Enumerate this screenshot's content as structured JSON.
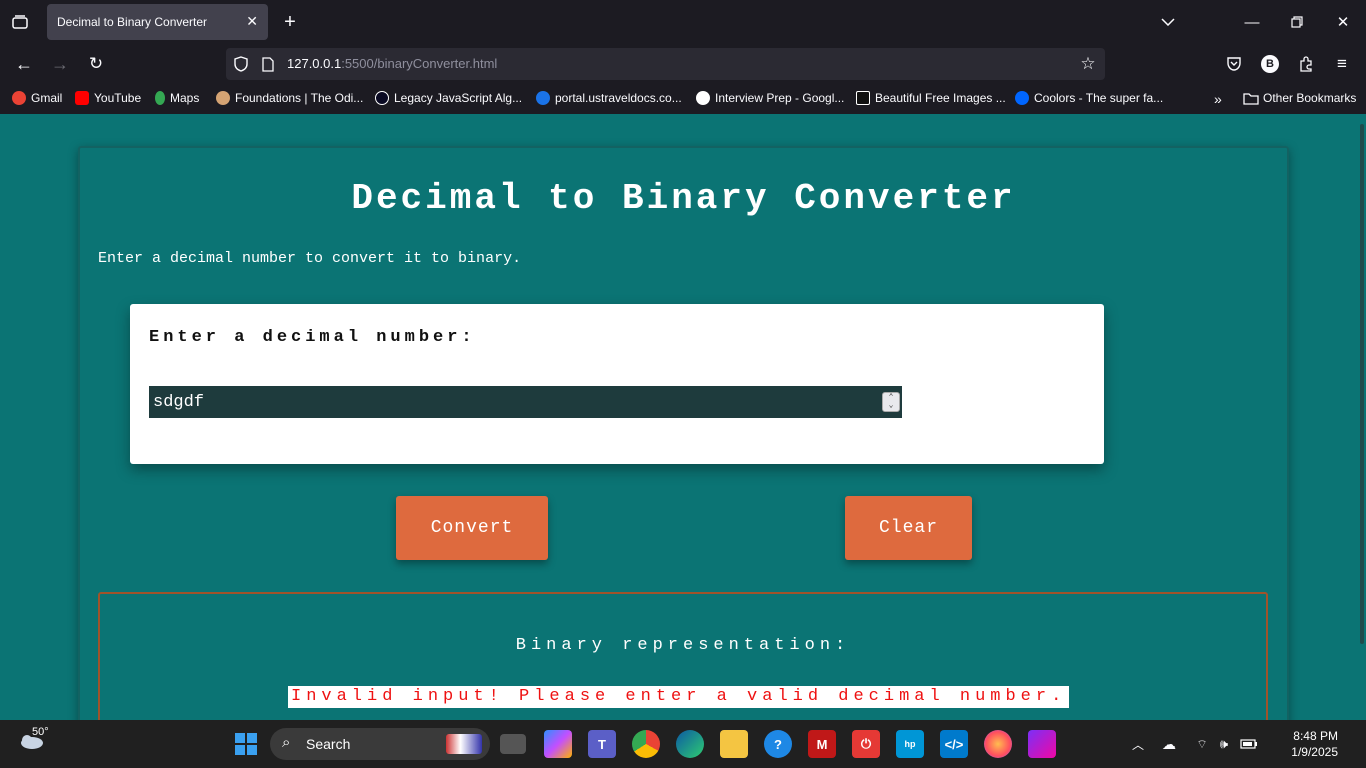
{
  "browser": {
    "tab_title": "Decimal to Binary Converter",
    "url_host": "127.0.0.1",
    "url_rest": ":5500/binaryConverter.html",
    "profile_initial": "B",
    "bookmarks": [
      {
        "label": "Gmail",
        "color": "#ea4335"
      },
      {
        "label": "YouTube",
        "color": "#ff0000"
      },
      {
        "label": "Maps",
        "color": "#34a853"
      },
      {
        "label": "Foundations | The Odi...",
        "color": "#d4a373"
      },
      {
        "label": "Legacy JavaScript Alg...",
        "color": "#0a0a23"
      },
      {
        "label": "portal.ustraveldocs.co...",
        "color": "#1a73e8"
      },
      {
        "label": "Interview Prep - Googl...",
        "color": "#ffffff"
      },
      {
        "label": "Beautiful Free Images ...",
        "color": "#111111"
      },
      {
        "label": "Coolors - The super fa...",
        "color": "#0066ff"
      }
    ],
    "other_bookmarks": "Other Bookmarks"
  },
  "app": {
    "title": "Decimal to Binary Converter",
    "subtitle": "Enter a decimal number to convert it to binary.",
    "input_label": "Enter a decimal number:",
    "input_value": "sdgdf",
    "convert_label": "Convert",
    "clear_label": "Clear",
    "result_label": "Binary representation:",
    "result_output": "Invalid input! Please enter a valid decimal number."
  },
  "taskbar": {
    "weather": "50°",
    "search_placeholder": "Search",
    "time": "8:48 PM",
    "date": "1/9/2025"
  }
}
